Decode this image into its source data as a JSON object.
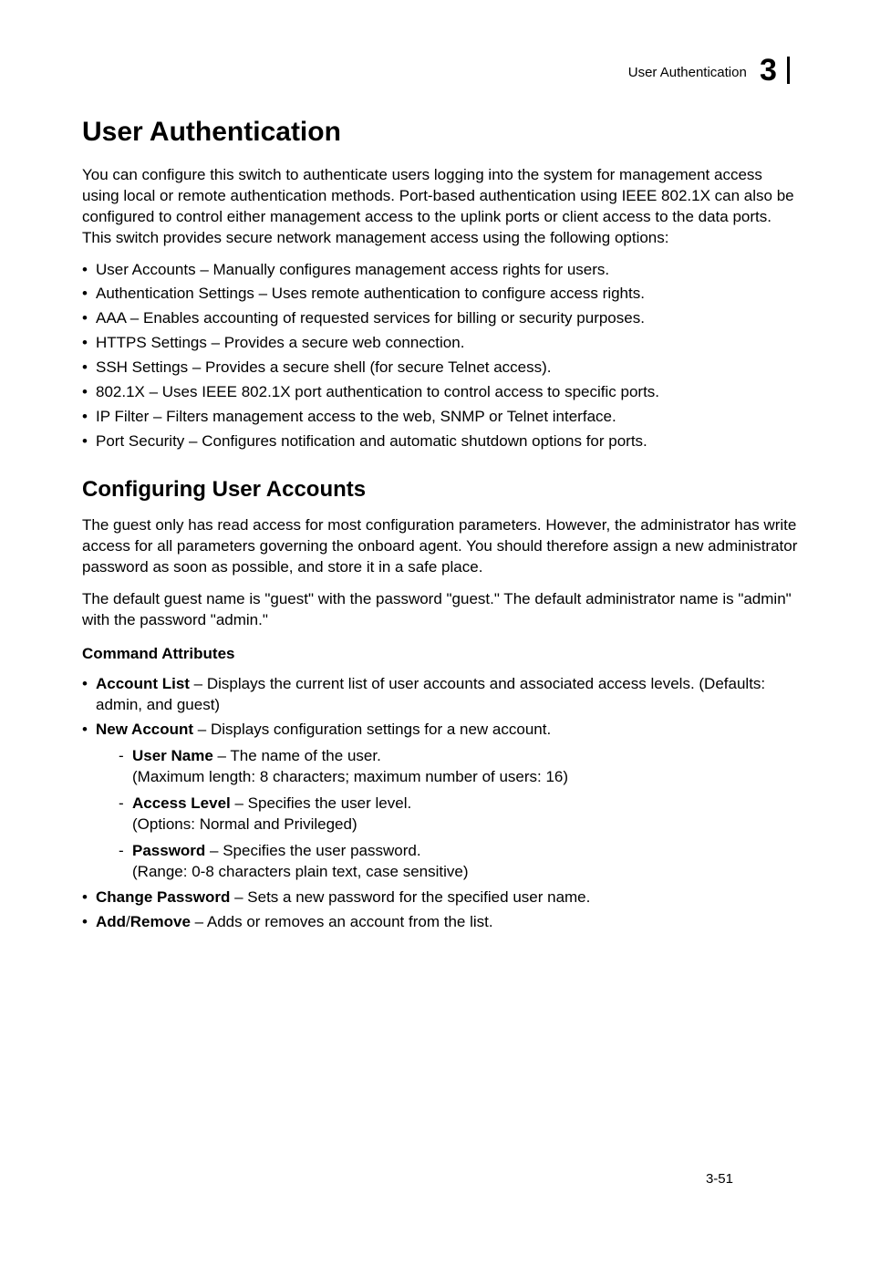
{
  "header": {
    "section_title": "User Authentication",
    "chapter_number": "3"
  },
  "h1": "User Authentication",
  "intro": "You can configure this switch to authenticate users logging into the system for management access using local or remote authentication methods. Port-based authentication using IEEE 802.1X can also be configured to control either management access to the uplink ports or client access to the data ports. This switch provides secure network management access using the following options:",
  "options": {
    "i0": "User Accounts – Manually configures management access rights for users.",
    "i1": "Authentication Settings – Uses remote authentication to configure access rights.",
    "i2": "AAA – Enables accounting of requested services for billing or security purposes.",
    "i3": "HTTPS Settings – Provides a secure web connection.",
    "i4": "SSH Settings – Provides a secure shell (for secure Telnet access).",
    "i5": "802.1X – Uses IEEE 802.1X port authentication to control access to specific ports.",
    "i6": "IP Filter – Filters management access to the web, SNMP or Telnet interface.",
    "i7": "Port Security – Configures notification and automatic shutdown options for ports."
  },
  "h2": "Configuring User Accounts",
  "para1": "The guest only has read access for most configuration parameters. However, the administrator has write access for all parameters governing the onboard agent. You should therefore assign a new administrator password as soon as possible, and store it in a safe place.",
  "para2": "The default guest name is \"guest\" with the password \"guest.\" The default administrator name is \"admin\" with the password \"admin.\"",
  "h3": "Command Attributes",
  "attrs": {
    "a0_label": "Account List",
    "a0_text": " – Displays the current list of user accounts and associated access levels. (Defaults: admin, and guest)",
    "a1_label": "New Account",
    "a1_text": " – Displays configuration settings for a new account.",
    "a1_sub": {
      "s0_label": "User Name",
      "s0_text": " – The name of the user.",
      "s0_note": "(Maximum length: 8 characters; maximum number of users: 16)",
      "s1_label": "Access Level",
      "s1_text": " – Specifies the user level.",
      "s1_note": "(Options: Normal and Privileged)",
      "s2_label": "Password",
      "s2_text": " – Specifies the user password.",
      "s2_note": "(Range: 0-8 characters plain text, case sensitive)"
    },
    "a2_label": "Change Password",
    "a2_text": " – Sets a new password for the specified user name.",
    "a3_label": "Add",
    "a3_sep": "/",
    "a3_label2": "Remove",
    "a3_text": " – Adds or removes an account from the list."
  },
  "footer": "3-51"
}
